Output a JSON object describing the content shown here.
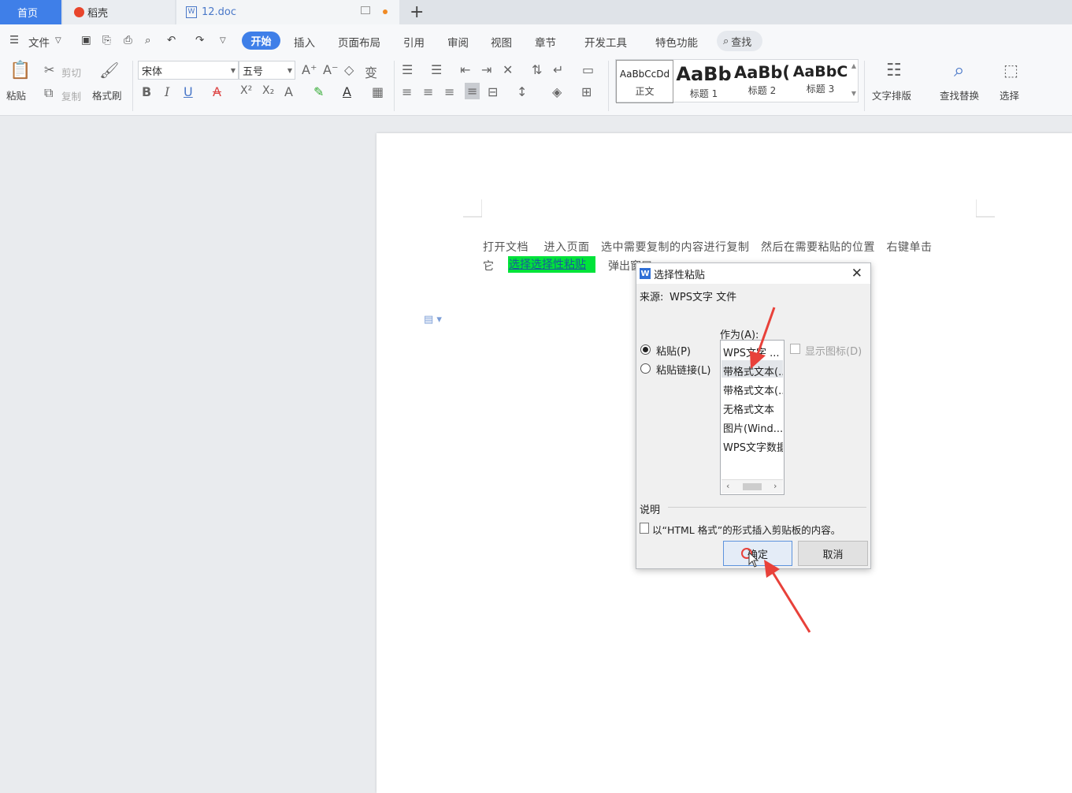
{
  "tabs": {
    "home": "首页",
    "daoke": "稻壳",
    "doc": "12.doc"
  },
  "menu": {
    "file": "文件",
    "items": [
      "开始",
      "插入",
      "页面布局",
      "引用",
      "审阅",
      "视图",
      "章节",
      "开发工具",
      "特色功能"
    ],
    "search": "查找"
  },
  "ribbon": {
    "paste": "粘贴",
    "cut": "剪切",
    "copy": "复制",
    "format_painter": "格式刷",
    "font_name": "宋体",
    "font_size": "五号",
    "styles": [
      {
        "preview": "AaBbCcDd",
        "name": "正文"
      },
      {
        "preview": "AaBb",
        "name": "标题 1"
      },
      {
        "preview": "AaBb(",
        "name": "标题 2"
      },
      {
        "preview": "AaBbC",
        "name": "标题 3"
      }
    ],
    "text_layout": "文字排版",
    "find_replace": "查找替换",
    "select": "选择"
  },
  "document": {
    "line1": "打开文档　 进入页面　选中需要复制的内容进行复制　然后在需要粘贴的位置　右键单击",
    "line2_start": "它",
    "highlight": "选择选择性粘贴",
    "line2_end": "弹出窗口"
  },
  "dialog": {
    "title": "选择性粘贴",
    "source_label": "来源:",
    "source_value": "WPS文字 文件",
    "as_label": "作为(A):",
    "radio_paste": "粘贴(P)",
    "radio_paste_link": "粘贴链接(L)",
    "show_icon": "显示图标(D)",
    "list_items": [
      "WPS文字 ...",
      "带格式文本(...",
      "带格式文本(...",
      "无格式文本",
      "图片(Wind...",
      "WPS文字数据"
    ],
    "selected_index": 1,
    "desc_label": "说明",
    "desc_text": "以“HTML 格式”的形式插入剪贴板的内容。",
    "ok": "确定",
    "cancel": "取消"
  },
  "colors": {
    "accent": "#3f7fe8",
    "highlight": "#00e33a",
    "arrow": "#e8413a"
  }
}
